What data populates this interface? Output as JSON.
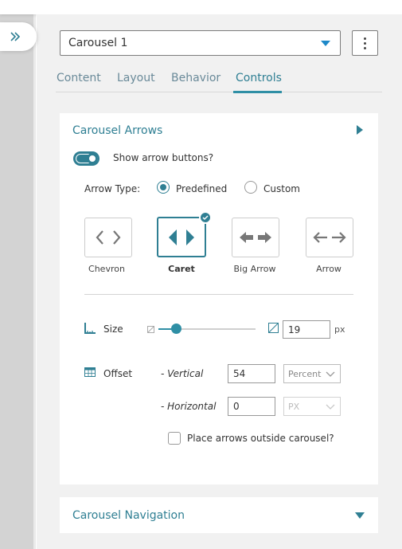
{
  "header": {
    "selected_carousel": "Carousel 1"
  },
  "tabs": [
    {
      "label": "Content"
    },
    {
      "label": "Layout"
    },
    {
      "label": "Behavior"
    },
    {
      "label": "Controls",
      "active": true
    }
  ],
  "arrows_section": {
    "title": "Carousel Arrows",
    "show_arrows_label": "Show arrow buttons?",
    "show_arrows_on": true,
    "arrow_type_label": "Arrow Type:",
    "arrow_type_options": [
      {
        "label": "Predefined",
        "selected": true
      },
      {
        "label": "Custom",
        "selected": false
      }
    ],
    "styles": [
      {
        "label": "Chevron",
        "selected": false
      },
      {
        "label": "Caret",
        "selected": true
      },
      {
        "label": "Big Arrow",
        "selected": false
      },
      {
        "label": "Arrow",
        "selected": false
      }
    ],
    "size_label": "Size",
    "size_value": "19",
    "size_unit": "px",
    "size_slider_fraction": 0.18,
    "offset_label": "Offset",
    "vertical_label": "- Vertical",
    "vertical_value": "54",
    "vertical_unit": "Percent",
    "horizontal_label": "- Horizontal",
    "horizontal_value": "0",
    "horizontal_unit": "PX",
    "outside_label": "Place arrows outside carousel?",
    "outside_checked": false
  },
  "navigation_section": {
    "title": "Carousel Navigation"
  },
  "colors": {
    "accent": "#2f7f93",
    "dropdown_caret": "#1e88c8"
  }
}
